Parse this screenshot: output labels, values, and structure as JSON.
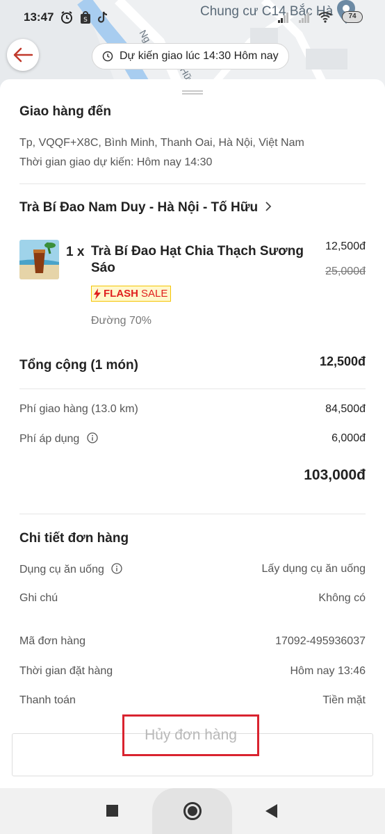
{
  "status_bar": {
    "time": "13:47",
    "battery": "74"
  },
  "map": {
    "location_label": "Chung cư C14 Bắc Hà",
    "road_label_1": "Ng",
    "road_label_2": "Hữ"
  },
  "header": {
    "eta": "Dự kiến giao lúc 14:30 Hôm nay"
  },
  "delivery": {
    "title": "Giao hàng đến",
    "address": "Tp, VQQF+X8C, Bình Minh, Thanh Oai, Hà Nội, Việt Nam",
    "eta": "Thời gian giao dự kiến: Hôm nay 14:30"
  },
  "store": {
    "name": "Trà Bí Đao Nam Duy - Hà Nội - Tố Hữu"
  },
  "item": {
    "qty": "1 x",
    "name": "Trà Bí Đao Hạt Chia Thạch Sương Sáo",
    "price": "12,500đ",
    "old_price": "25,000đ",
    "flash_label_1": "FLASH",
    "flash_label_2": "SALE",
    "option": "Đường 70%"
  },
  "summary": {
    "total_label": "Tổng cộng (1 món)",
    "total_value": "12,500đ",
    "shipping_label": "Phí giao hàng (13.0 km)",
    "shipping_value": "84,500đ",
    "fee_label": "Phí áp dụng",
    "fee_value": "6,000đ",
    "grand_total": "103,000đ"
  },
  "details": {
    "title": "Chi tiết đơn hàng",
    "utensils_label": "Dụng cụ ăn uống",
    "utensils_value": "Lấy dụng cụ ăn uống",
    "note_label": "Ghi chú",
    "note_value": "Không có",
    "order_id_label": "Mã đơn hàng",
    "order_id_value": "17092-495936037",
    "order_time_label": "Thời gian đặt hàng",
    "order_time_value": "Hôm nay 13:46",
    "payment_label": "Thanh toán",
    "payment_value": "Tiền mặt"
  },
  "actions": {
    "cancel_label": "Hủy đơn hàng"
  },
  "colors": {
    "accent": "#d9232f",
    "back_arrow": "#c0392b",
    "flash_yellow": "#f5c400",
    "flash_red": "#e02020"
  },
  "icons": [
    "back-arrow-icon",
    "clock-icon",
    "chevron-right-icon",
    "info-icon",
    "alarm-icon",
    "map-pin-icon",
    "wifi-icon",
    "signal-icon"
  ]
}
